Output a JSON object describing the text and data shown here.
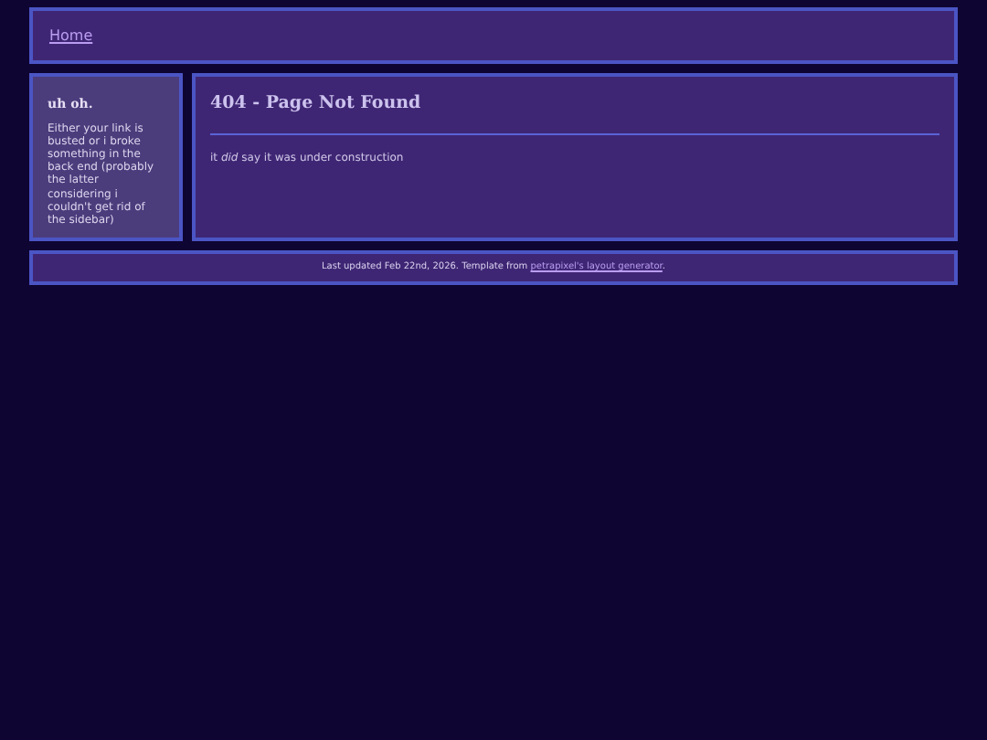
{
  "header": {
    "nav_link": "Home"
  },
  "sidebar": {
    "title": "uh oh.",
    "text": "Either your link is busted or i broke something in the back end (probably the latter considering i couldn't get rid of the sidebar)"
  },
  "main": {
    "title": "404 - Page Not Found",
    "text": "it *did* say it was under construction"
  },
  "footer": {
    "text": "Last updated Feb 22nd, 2026. Template from ",
    "link": "petrapixel's layout generator",
    "text_after": "."
  }
}
